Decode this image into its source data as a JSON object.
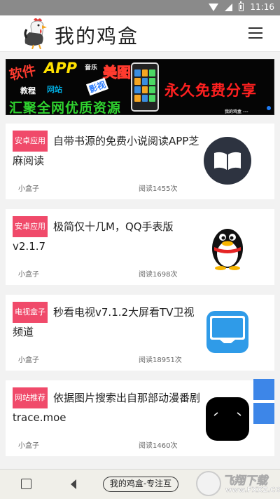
{
  "status_bar": {
    "time": "11:16",
    "icons": [
      "wifi-icon",
      "signal-icon",
      "battery-icon"
    ]
  },
  "header": {
    "title": "我的鸡盒",
    "logo_icon": "rooster-logo-icon",
    "menu_icon": "hamburger-menu-icon"
  },
  "banner": {
    "words": {
      "ruanjian": "软件",
      "app": "APP",
      "yinyue": "音乐",
      "meitu": "美图",
      "jiaocheng": "教程",
      "wangzhan": "网站",
      "yingshi": "影视",
      "huiju": "汇聚全网优质资源",
      "yongjiu": "永久免费分享",
      "small": "我的鸡盒 --- wodejihe.com"
    },
    "active_dot_color": "#1e7cf5"
  },
  "articles": [
    {
      "tag": "安卓应用",
      "title": "自带书源的免费小说阅读APP芝麻阅读",
      "author": "小盒子",
      "reads": "阅读1455次",
      "thumb_icon": "book-icon"
    },
    {
      "tag": "安卓应用",
      "title": "极简仅十几M，QQ手表版v2.1.7",
      "author": "小盒子",
      "reads": "阅读1698次",
      "thumb_icon": "qq-penguin-icon"
    },
    {
      "tag": "电视盒子",
      "title": "秒看电视v7.1.2大屏看TV卫视频道",
      "author": "小盒子",
      "reads": "阅读18951次",
      "thumb_icon": "tv-app-icon"
    },
    {
      "tag": "网站推荐",
      "title": "依据图片搜索出自那部动漫番剧trace.moe",
      "author": "小盒子",
      "reads": "阅读1460次",
      "thumb_icon": "trace-moe-icon"
    }
  ],
  "tag_color": "#f04a6a",
  "side_button_color": "#3d86e8",
  "bottom_bar": {
    "pill_text": "我的鸡盒-专注互",
    "watermark_text": "飞翔下载",
    "watermark_url": "www.FXXZ.COM"
  }
}
